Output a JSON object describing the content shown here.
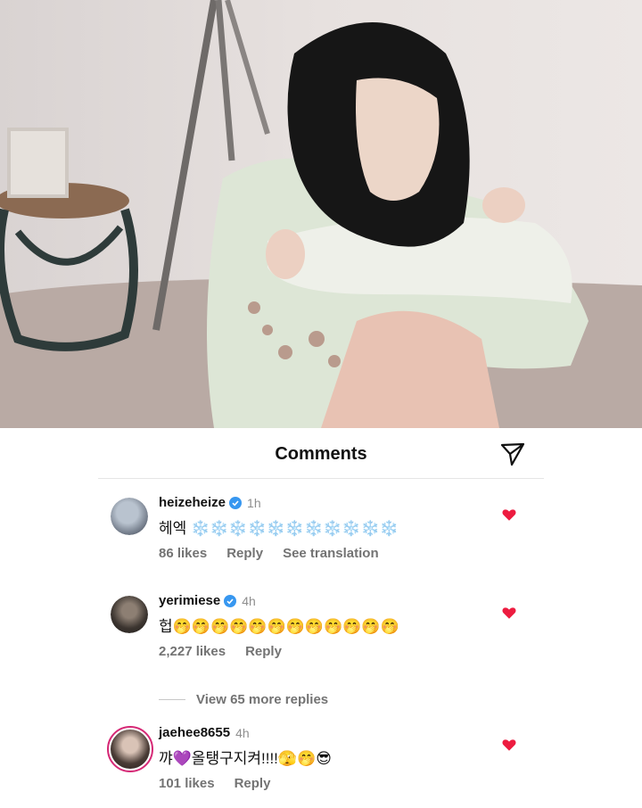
{
  "colors": {
    "heart": "#ed1c40",
    "verified": "#3797f0",
    "story_ring": "#d62976"
  },
  "sheet": {
    "title": "Comments",
    "share_icon": "paper-plane-icon"
  },
  "comments": [
    {
      "username": "heizeheize",
      "verified": true,
      "time": "1h",
      "text": "헤엑 ❄️❄️❄️❄️❄️❄️❄️❄️❄️❄️❄️",
      "likes": "86 likes",
      "reply": "Reply",
      "translate": "See translation"
    },
    {
      "username": "yerimiese",
      "verified": true,
      "time": "4h",
      "text": "헙🤭🤭🤭🤭🤭🤭🤭🤭🤭🤭🤭🤭",
      "likes": "2,227 likes",
      "reply": "Reply"
    },
    {
      "username": "jaehee8655",
      "verified": false,
      "time": "4h",
      "text": "꺄💜올탱구지켜!!!!🫣🤭😎",
      "likes": "101 likes",
      "reply": "Reply"
    }
  ],
  "view_more": "View 65 more replies"
}
